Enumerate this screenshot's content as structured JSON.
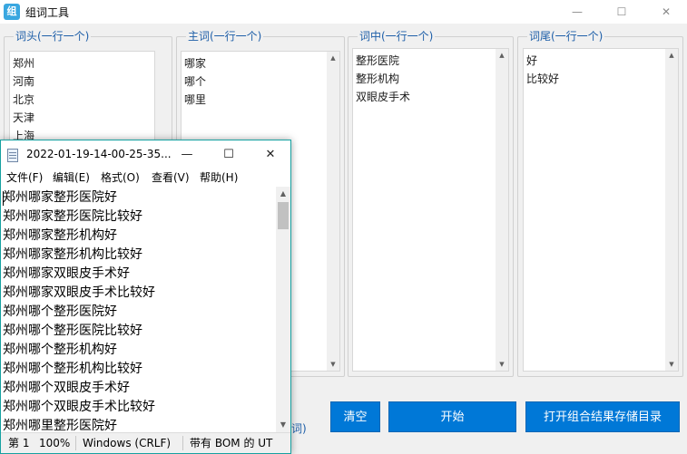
{
  "app": {
    "title": "组词工具",
    "icon_glyph": "组",
    "controls": {
      "minimize": "—",
      "maximize": "☐",
      "close": "✕"
    },
    "groups": [
      {
        "label": "词头(一行一个)",
        "words": [
          "郑州",
          "河南",
          "北京",
          "天津",
          "上海"
        ]
      },
      {
        "label": "主词(一行一个)",
        "words": [
          "哪家",
          "哪个",
          "哪里"
        ]
      },
      {
        "label": "词中(一行一个)",
        "words": [
          "整形医院",
          "整形机构",
          "双眼皮手术"
        ]
      },
      {
        "label": "词尾(一行一个)",
        "words": [
          "好",
          "比较好"
        ]
      }
    ],
    "hidden_label_fragment": "词)",
    "buttons": {
      "clear": "清空",
      "start": "开始",
      "open_dir": "打开组合结果存储目录"
    }
  },
  "notepad": {
    "title": "2022-01-19-14-00-25-35...",
    "controls": {
      "minimize": "—",
      "maximize": "☐",
      "close": "✕"
    },
    "menu": [
      "文件(F)",
      "编辑(E)",
      "格式(O)",
      "查看(V)",
      "帮助(H)"
    ],
    "lines": [
      "郑州哪家整形医院好",
      "郑州哪家整形医院比较好",
      "郑州哪家整形机构好",
      "郑州哪家整形机构比较好",
      "郑州哪家双眼皮手术好",
      "郑州哪家双眼皮手术比较好",
      "郑州哪个整形医院好",
      "郑州哪个整形医院比较好",
      "郑州哪个整形机构好",
      "郑州哪个整形机构比较好",
      "郑州哪个双眼皮手术好",
      "郑州哪个双眼皮手术比较好",
      "郑州哪里整形医院好"
    ],
    "status": {
      "position": "第 1",
      "zoom": "100%",
      "line_ending": "Windows (CRLF)",
      "encoding": "带有 BOM 的 UT"
    }
  }
}
